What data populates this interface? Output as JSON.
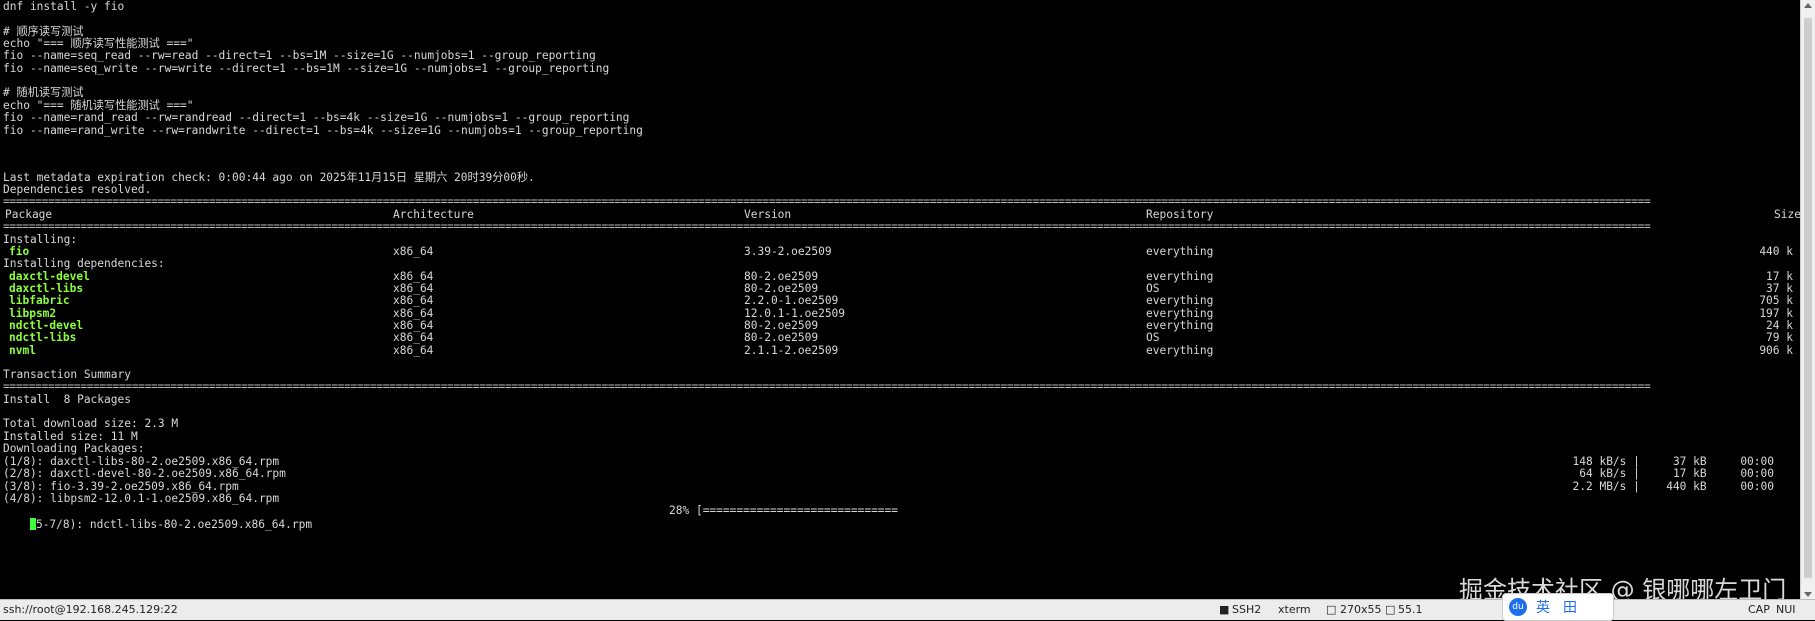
{
  "script_lines": [
    "dnf install -y fio",
    "",
    "# 顺序读写测试",
    "echo \"=== 顺序读写性能测试 ===\"",
    "fio --name=seq_read --rw=read --direct=1 --bs=1M --size=1G --numjobs=1 --group_reporting",
    "fio --name=seq_write --rw=write --direct=1 --bs=1M --size=1G --numjobs=1 --group_reporting",
    "",
    "# 随机读写测试",
    "echo \"=== 随机读写性能测试 ===\"",
    "fio --name=rand_read --rw=randread --direct=1 --bs=4k --size=1G --numjobs=1 --group_reporting",
    "fio --name=rand_write --rw=randwrite --direct=1 --bs=4k --size=1G --numjobs=1 --group_reporting"
  ],
  "metadata_line": "Last metadata expiration check: 0:00:44 ago on 2025年11月15日 星期六 20时39分00秒.",
  "deps_resolved": "Dependencies resolved.",
  "table_headers": {
    "package": "Package",
    "architecture": "Architecture",
    "version": "Version",
    "repository": "Repository",
    "size": "Size"
  },
  "installing_label": "Installing:",
  "installing": [
    {
      "name": "fio",
      "arch": "x86_64",
      "version": "3.39-2.oe2509",
      "repo": "everything",
      "size": "440 k"
    }
  ],
  "deps_label": "Installing dependencies:",
  "dependencies": [
    {
      "name": "daxctl-devel",
      "arch": "x86_64",
      "version": "80-2.oe2509",
      "repo": "everything",
      "size": "17 k"
    },
    {
      "name": "daxctl-libs",
      "arch": "x86_64",
      "version": "80-2.oe2509",
      "repo": "OS",
      "size": "37 k"
    },
    {
      "name": "libfabric",
      "arch": "x86_64",
      "version": "2.2.0-1.oe2509",
      "repo": "everything",
      "size": "705 k"
    },
    {
      "name": "libpsm2",
      "arch": "x86_64",
      "version": "12.0.1-1.oe2509",
      "repo": "everything",
      "size": "197 k"
    },
    {
      "name": "ndctl-devel",
      "arch": "x86_64",
      "version": "80-2.oe2509",
      "repo": "everything",
      "size": "24 k"
    },
    {
      "name": "ndctl-libs",
      "arch": "x86_64",
      "version": "80-2.oe2509",
      "repo": "OS",
      "size": "79 k"
    },
    {
      "name": "nvml",
      "arch": "x86_64",
      "version": "2.1.1-2.oe2509",
      "repo": "everything",
      "size": "906 k"
    }
  ],
  "transaction_summary": "Transaction Summary",
  "install_count": "Install  8 Packages",
  "total_download": "Total download size: 2.3 M",
  "installed_size": "Installed size: 11 M",
  "downloading_label": "Downloading Packages:",
  "downloads": [
    {
      "file": "(1/8): daxctl-libs-80-2.oe2509.x86_64.rpm",
      "speed": "148 kB/s",
      "size": "37 kB",
      "time": "00:00"
    },
    {
      "file": "(2/8): daxctl-devel-80-2.oe2509.x86_64.rpm",
      "speed": "64 kB/s",
      "size": "17 kB",
      "time": "00:00"
    },
    {
      "file": "(3/8): fio-3.39-2.oe2509.x86_64.rpm",
      "speed": "2.2 MB/s",
      "size": "440 kB",
      "time": "00:00"
    },
    {
      "file": "(4/8): libpsm2-12.0.1-1.oe2509.x86_64.rpm",
      "speed": "",
      "size": "",
      "time": ""
    }
  ],
  "current_download": {
    "file": "5-7/8): ndctl-libs-80-2.oe2509.x86_64.rpm",
    "percent_text": "28% [",
    "bar_text": "=============================",
    "progress": 0.28
  },
  "watermark": "掘金技术社区 @ 银哪哪左卫门",
  "status_bar": {
    "connection": "ssh://root@192.168.245.129:22",
    "protocol": "SSH2",
    "terminal": "xterm",
    "size": "270x55",
    "position": "55.1",
    "cap": "CAP",
    "num": "NUI"
  },
  "ime": {
    "logo": "du",
    "lang": "英",
    "grid": "田"
  },
  "colors": {
    "background": "#000000",
    "text": "#d8d8d8",
    "package_name": "#8cff3c"
  }
}
